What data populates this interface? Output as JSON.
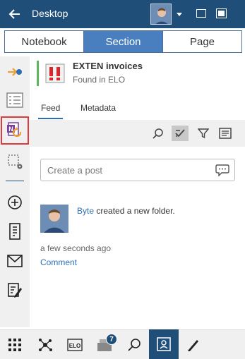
{
  "titlebar": {
    "title": "Desktop"
  },
  "segments": [
    "Notebook",
    "Section",
    "Page"
  ],
  "document": {
    "title": "EXTEN invoices",
    "subtitle": "Found in ELO"
  },
  "tabs": {
    "feed": "Feed",
    "metadata": "Metadata"
  },
  "post": {
    "placeholder": "Create a post"
  },
  "feed_item": {
    "user": "Byte",
    "action": " created a new folder.",
    "time": "a few seconds ago",
    "comment": "Comment"
  },
  "bottombar": {
    "elo_label": "ELO",
    "badge_count": "7"
  },
  "colors": {
    "titlebar": "#1f4e79",
    "active_segment": "#4a7fbf",
    "link": "#2d6fb7",
    "selection": "#e0393e",
    "status_bar": "#5cb85c"
  }
}
